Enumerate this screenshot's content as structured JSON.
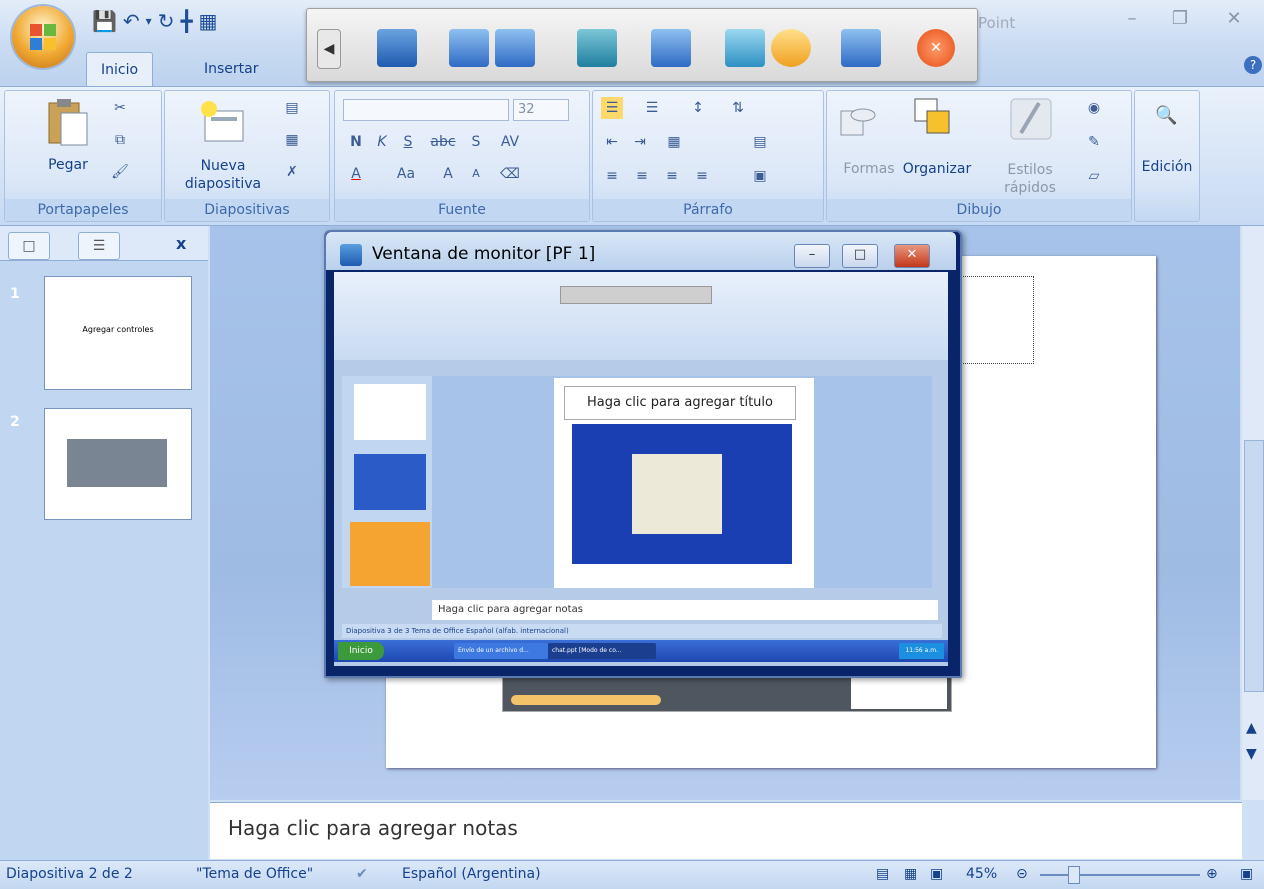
{
  "app": {
    "title_fragment": "Point"
  },
  "tabs": [
    {
      "label": "Inicio"
    },
    {
      "label": "Insertar"
    }
  ],
  "ribbon": {
    "portapapeles": {
      "label": "Portapapeles",
      "paste": "Pegar"
    },
    "diapositivas": {
      "label": "Diapositivas",
      "nueva": "Nueva",
      "nueva2": "diapositiva"
    },
    "fuente": {
      "label": "Fuente",
      "size": "32"
    },
    "parrafo": {
      "label": "Párrafo"
    },
    "dibujo": {
      "label": "Dibujo",
      "formas": "Formas",
      "organizar": "Organizar",
      "estilos": "Estilos",
      "rapidos": "rápidos"
    },
    "edicion": {
      "label": "Edición"
    }
  },
  "slides_panel": {
    "close": "x",
    "slides": [
      {
        "num": "1",
        "title": "Agregar controles"
      },
      {
        "num": "2"
      }
    ]
  },
  "notes": {
    "placeholder": "Haga clic para agregar notas"
  },
  "status": {
    "slide": "Diapositiva 2 de 2",
    "theme": "\"Tema de Office\"",
    "language": "Español (Argentina)",
    "zoom": "45%"
  },
  "monitor_window": {
    "title": "Ventana de monitor [PF 1]",
    "inner": {
      "slide_title": "Haga clic para agregar título",
      "notes": "Haga clic para agregar notas",
      "status": "Diapositiva 3 de 3   Tema de Office   Español (alfab. internacional)",
      "taskbar_start": "Inicio",
      "taskbar_item1": "Envío de un archivo d...",
      "taskbar_item2": "chat.ppt [Modo de co...",
      "clock": "11:56 a.m."
    }
  },
  "colors": {
    "ribbon_bg": "#dbe7f7",
    "accent": "#15428b",
    "slide_bg": "#ffffff",
    "close_red": "#c2371a"
  }
}
